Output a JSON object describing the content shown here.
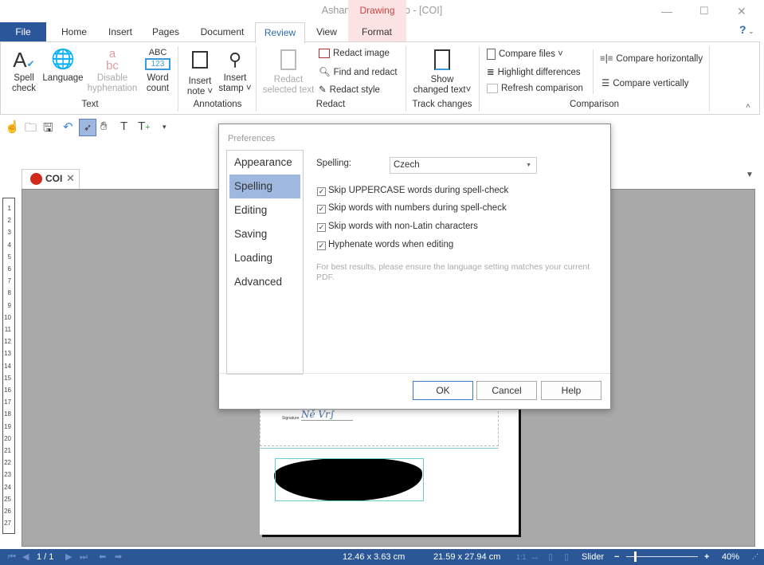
{
  "window": {
    "title": "Ashampoo PDF Pro - [COI]",
    "context_group": "Drawing",
    "help": "?"
  },
  "tabs": [
    "File",
    "Home",
    "Insert",
    "Pages",
    "Document",
    "Review",
    "View",
    "Format"
  ],
  "ribbon": {
    "text_group": {
      "label": "Text",
      "spell_check": [
        "Spell",
        "check"
      ],
      "language": "Language",
      "disable_hyphenation": [
        "Disable",
        "hyphenation"
      ],
      "word_count": [
        "Word",
        "count"
      ],
      "word_count_icon": [
        "ABC",
        "123"
      ]
    },
    "annotations_group": {
      "label": "Annotations",
      "insert_note": [
        "Insert",
        "note"
      ],
      "insert_stamp": [
        "Insert",
        "stamp"
      ]
    },
    "redact_group": {
      "label": "Redact",
      "redact_selected": [
        "Redact",
        "selected text"
      ],
      "redact_image": "Redact image",
      "find_and_redact": "Find and redact",
      "redact_style": "Redact style"
    },
    "track_group": {
      "label": "Track changes",
      "show_changed": [
        "Show",
        "changed text"
      ]
    },
    "comparison_group": {
      "label": "Comparison",
      "compare_files": "Compare files",
      "highlight_differences": "Highlight differences",
      "refresh_comparison": "Refresh comparison",
      "compare_horizontally": "Compare horizontally",
      "compare_vertically": "Compare vertically"
    }
  },
  "document_tab": {
    "name": "COI"
  },
  "ruler": [
    "1",
    "2",
    "3",
    "4",
    "5",
    "6",
    "7",
    "8",
    "9",
    "10",
    "11",
    "12",
    "13",
    "14",
    "15",
    "16",
    "17",
    "18",
    "19",
    "20",
    "21",
    "22",
    "23",
    "24",
    "25",
    "26",
    "27"
  ],
  "page": {
    "signature_label": "Signature"
  },
  "dialog": {
    "title": "Preferences",
    "nav": [
      "Appearance",
      "Spelling",
      "Editing",
      "Saving",
      "Loading",
      "Advanced"
    ],
    "selected": "Spelling",
    "spelling_label": "Spelling:",
    "spelling_value": "Czech",
    "options": [
      {
        "label": "Skip UPPERCASE words during spell-check",
        "checked": true
      },
      {
        "label": "Skip words with numbers during spell-check",
        "checked": true
      },
      {
        "label": "Skip words with non-Latin characters",
        "checked": true
      },
      {
        "label": "Hyphenate words when editing",
        "checked": true
      }
    ],
    "hint": "For best results, please ensure the language setting matches your current PDF.",
    "ok": "OK",
    "cancel": "Cancel",
    "help": "Help"
  },
  "status": {
    "page": "1 / 1",
    "selection_size": "12.46 x 3.63 cm",
    "page_size": "21.59 x 27.94 cm",
    "zoom_mode": "Slider",
    "zoom_percent": "40%",
    "zoom_fraction": 0.4
  }
}
